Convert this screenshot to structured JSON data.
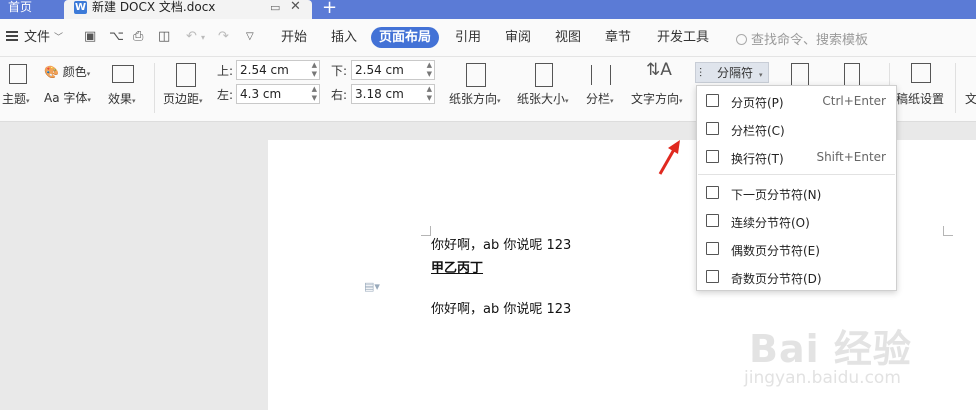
{
  "tabs": {
    "home": "首页",
    "document_title": "新建 DOCX 文档.docx",
    "doc_icon_letter": "W"
  },
  "menu": {
    "file": "文件",
    "items": [
      "开始",
      "插入",
      "页面布局",
      "引用",
      "审阅",
      "视图",
      "章节",
      "开发工具"
    ],
    "active": "页面布局",
    "search_placeholder": "查找命令、搜索模板"
  },
  "ribbon": {
    "theme": "主题",
    "colors": "颜色",
    "fonts": "字体",
    "effects": "效果",
    "margins": "页边距",
    "margin_top_label": "上:",
    "margin_top_value": "2.54 cm",
    "margin_bottom_label": "下:",
    "margin_bottom_value": "2.54 cm",
    "margin_left_label": "左:",
    "margin_left_value": "4.3 cm",
    "margin_right_label": "右:",
    "margin_right_value": "3.18 cm",
    "orientation": "纸张方向",
    "size": "纸张大小",
    "columns": "分栏",
    "text_direction": "文字方向",
    "breaks": "分隔符",
    "manuscript": "稿纸设置",
    "overflow_label": "文"
  },
  "dropdown": {
    "items": [
      {
        "icon": "page-break-icon",
        "label": "分页符(P)",
        "shortcut": "Ctrl+Enter"
      },
      {
        "icon": "column-break-icon",
        "label": "分栏符(C)",
        "shortcut": ""
      },
      {
        "icon": "line-break-icon",
        "label": "换行符(T)",
        "shortcut": "Shift+Enter"
      },
      {
        "icon": "next-page-section-icon",
        "label": "下一页分节符(N)",
        "shortcut": ""
      },
      {
        "icon": "continuous-section-icon",
        "label": "连续分节符(O)",
        "shortcut": ""
      },
      {
        "icon": "even-page-section-icon",
        "label": "偶数页分节符(E)",
        "shortcut": ""
      },
      {
        "icon": "odd-page-section-icon",
        "label": "奇数页分节符(D)",
        "shortcut": ""
      }
    ]
  },
  "document": {
    "line1": "你好啊，ab 你说呢 123",
    "heading": "甲乙丙丁",
    "line3": "你好啊，ab 你说呢 123"
  },
  "watermark": {
    "logo": "Bai 经验",
    "url": "jingyan.baidu.com"
  },
  "colors": {
    "tabbar": "#5b7bd6",
    "active_tab": "#4372d6",
    "arrow": "#e0291f"
  }
}
